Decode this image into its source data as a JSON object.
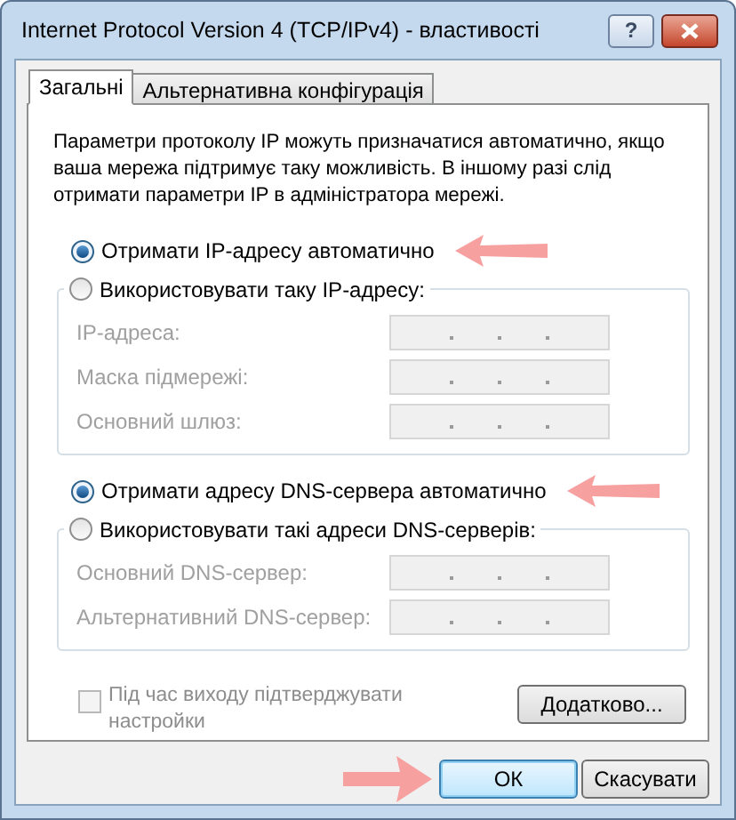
{
  "window": {
    "title": "Internet Protocol Version 4 (TCP/IPv4) - властивості"
  },
  "title_buttons": [
    {
      "kind": "help",
      "label": "?"
    },
    {
      "kind": "close"
    }
  ],
  "tabs": [
    {
      "label": "Загальні",
      "selected": true
    },
    {
      "label": "Альтернативна конфігурація",
      "selected": false
    }
  ],
  "description": "Параметри протоколу IP можуть призначатися автоматично, якщо ваша мережа підтримує таку можливість. В іншому разі слід отримати параметри IP в адміністратора мережі.",
  "sections": [
    {
      "auto": {
        "label": "Отримати IP-адресу автоматично",
        "selected": true,
        "marked": true
      },
      "manual": {
        "label": "Використовувати таку IP-адресу:",
        "selected": false
      },
      "fields": [
        {
          "label": "IP-адреса:",
          "disabled": true
        },
        {
          "label": "Маска підмережі:",
          "disabled": true
        },
        {
          "label": "Основний шлюз:",
          "disabled": true
        }
      ]
    },
    {
      "auto": {
        "label": "Отримати адресу DNS-сервера автоматично",
        "selected": true,
        "marked": true
      },
      "manual": {
        "label": "Використовувати такі адреси DNS-серверів:",
        "selected": false
      },
      "fields": [
        {
          "label": "Основний DNS-сервер:",
          "disabled": true
        },
        {
          "label": "Альтернативний DNS-сервер:",
          "disabled": true
        }
      ]
    }
  ],
  "validate": {
    "label": "Під час виходу підтверджувати настройки",
    "checked": false,
    "disabled": true
  },
  "advanced_button": "Додатково...",
  "buttons": [
    {
      "label": "ОК",
      "default": true,
      "marked": true
    },
    {
      "label": "Скасувати",
      "default": false,
      "marked": false
    }
  ]
}
